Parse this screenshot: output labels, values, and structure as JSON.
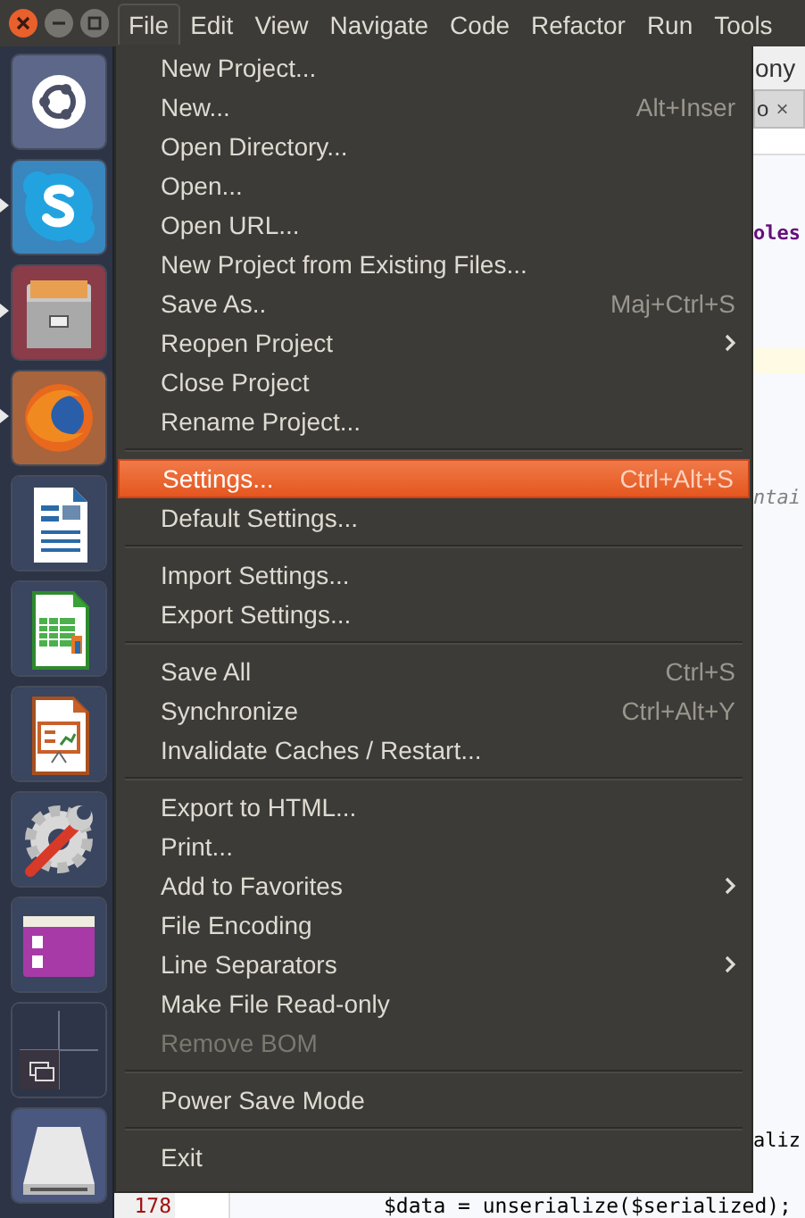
{
  "window_controls": [
    {
      "kind": "close"
    },
    {
      "kind": "minimize"
    },
    {
      "kind": "maximize"
    }
  ],
  "menubar": [
    {
      "label": "File",
      "selected": true
    },
    {
      "label": "Edit",
      "selected": false
    },
    {
      "label": "View",
      "selected": false
    },
    {
      "label": "Navigate",
      "selected": false
    },
    {
      "label": "Code",
      "selected": false
    },
    {
      "label": "Refactor",
      "selected": false
    },
    {
      "label": "Run",
      "selected": false
    },
    {
      "label": "Tools",
      "selected": false
    }
  ],
  "launcher": [
    {
      "kind": "ring",
      "running": false
    },
    {
      "kind": "chat",
      "running": true
    },
    {
      "kind": "cabinet",
      "running": true
    },
    {
      "kind": "globe",
      "running": true
    },
    {
      "kind": "writer",
      "running": false
    },
    {
      "kind": "calc",
      "running": false
    },
    {
      "kind": "impress",
      "running": false
    },
    {
      "kind": "settings",
      "running": false
    },
    {
      "kind": "window",
      "running": false
    },
    {
      "kind": "workspaces",
      "running": false
    },
    {
      "kind": "drive",
      "running": false
    }
  ],
  "file_menu": [
    {
      "kind": "item",
      "label": "New Project...",
      "selected": false,
      "disabled": false,
      "submenu": false
    },
    {
      "kind": "item",
      "label": "New...",
      "shortcut": "Alt+Inser",
      "selected": false,
      "disabled": false,
      "submenu": false
    },
    {
      "kind": "item",
      "label": "Open Directory...",
      "selected": false,
      "disabled": false,
      "submenu": false
    },
    {
      "kind": "item",
      "label": "Open...",
      "selected": false,
      "disabled": false,
      "submenu": false
    },
    {
      "kind": "item",
      "label": "Open URL...",
      "selected": false,
      "disabled": false,
      "submenu": false
    },
    {
      "kind": "item",
      "label": "New Project from Existing Files...",
      "selected": false,
      "disabled": false,
      "submenu": false
    },
    {
      "kind": "item",
      "label": "Save As..",
      "shortcut": "Maj+Ctrl+S",
      "selected": false,
      "disabled": false,
      "submenu": false
    },
    {
      "kind": "item",
      "label": "Reopen Project",
      "selected": false,
      "disabled": false,
      "submenu": true
    },
    {
      "kind": "item",
      "label": "Close Project",
      "selected": false,
      "disabled": false,
      "submenu": false
    },
    {
      "kind": "item",
      "label": "Rename Project...",
      "selected": false,
      "disabled": false,
      "submenu": false
    },
    {
      "kind": "separator"
    },
    {
      "kind": "item",
      "label": "Settings...",
      "shortcut": "Ctrl+Alt+S",
      "selected": true,
      "disabled": false,
      "submenu": false
    },
    {
      "kind": "item",
      "label": "Default Settings...",
      "selected": false,
      "disabled": false,
      "submenu": false
    },
    {
      "kind": "separator"
    },
    {
      "kind": "item",
      "label": "Import Settings...",
      "selected": false,
      "disabled": false,
      "submenu": false
    },
    {
      "kind": "item",
      "label": "Export Settings...",
      "selected": false,
      "disabled": false,
      "submenu": false
    },
    {
      "kind": "separator"
    },
    {
      "kind": "item",
      "label": "Save All",
      "shortcut": "Ctrl+S",
      "selected": false,
      "disabled": false,
      "submenu": false
    },
    {
      "kind": "item",
      "label": "Synchronize",
      "shortcut": "Ctrl+Alt+Y",
      "selected": false,
      "disabled": false,
      "submenu": false
    },
    {
      "kind": "item",
      "label": "Invalidate Caches / Restart...",
      "selected": false,
      "disabled": false,
      "submenu": false
    },
    {
      "kind": "separator"
    },
    {
      "kind": "item",
      "label": "Export to HTML...",
      "selected": false,
      "disabled": false,
      "submenu": false
    },
    {
      "kind": "item",
      "label": "Print...",
      "selected": false,
      "disabled": false,
      "submenu": false
    },
    {
      "kind": "item",
      "label": "Add to Favorites",
      "selected": false,
      "disabled": false,
      "submenu": true
    },
    {
      "kind": "item",
      "label": "File Encoding",
      "selected": false,
      "disabled": false,
      "submenu": false
    },
    {
      "kind": "item",
      "label": "Line Separators",
      "selected": false,
      "disabled": false,
      "submenu": true
    },
    {
      "kind": "item",
      "label": "Make File Read-only",
      "selected": false,
      "disabled": false,
      "submenu": false
    },
    {
      "kind": "item",
      "label": "Remove BOM",
      "selected": false,
      "disabled": true,
      "submenu": false
    },
    {
      "kind": "separator"
    },
    {
      "kind": "item",
      "label": "Power Save Mode",
      "selected": false,
      "disabled": false,
      "submenu": false
    },
    {
      "kind": "separator"
    },
    {
      "kind": "item",
      "label": "Exit",
      "selected": false,
      "disabled": false,
      "submenu": false
    }
  ],
  "editor": {
    "title_fragment": "ony",
    "tab": {
      "label": "o",
      "close": "×"
    },
    "fragments": [
      {
        "kind": "keyword",
        "text": "oles"
      },
      {
        "kind": "highlight"
      },
      {
        "kind": "comment",
        "text": "ntai"
      },
      {
        "kind": "code",
        "text": "aliz"
      }
    ],
    "bottom_line": {
      "number": "178",
      "code": "$data = unserialize($serialized);"
    }
  }
}
